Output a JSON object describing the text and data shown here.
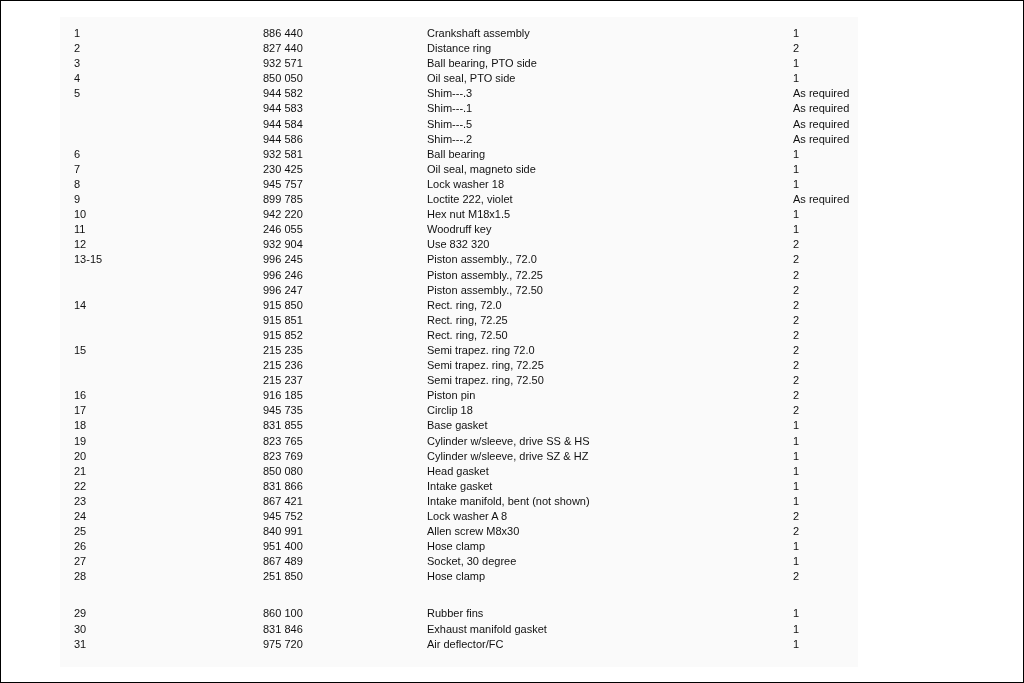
{
  "parts_list": {
    "row_groups": [
      [
        {
          "item": "1",
          "part_no": "886 440",
          "description": "Crankshaft assembly",
          "qty": "1"
        },
        {
          "item": "2",
          "part_no": "827 440",
          "description": "Distance ring",
          "qty": "2"
        },
        {
          "item": "3",
          "part_no": "932 571",
          "description": "Ball bearing, PTO side",
          "qty": "1"
        },
        {
          "item": "4",
          "part_no": "850 050",
          "description": "Oil seal, PTO side",
          "qty": "1"
        },
        {
          "item": "5",
          "part_no": "944 582",
          "description": "Shim---.3",
          "qty": "As required"
        },
        {
          "part_no": "944 583",
          "description": "Shim---.1",
          "qty": "As required"
        },
        {
          "part_no": "944 584",
          "description": "Shim---.5",
          "qty": "As required"
        },
        {
          "part_no": "944 586",
          "description": "Shim---.2",
          "qty": "As required"
        },
        {
          "item": "6",
          "part_no": "932 581",
          "description": "Ball bearing",
          "qty": "1"
        },
        {
          "item": "7",
          "part_no": "230 425",
          "description": "Oil seal, magneto side",
          "qty": "1"
        },
        {
          "item": "8",
          "part_no": "945 757",
          "description": "Lock washer 18",
          "qty": "1"
        },
        {
          "item": "9",
          "part_no": "899 785",
          "description": "Loctite 222, violet",
          "qty": "As required"
        },
        {
          "item": "10",
          "part_no": "942 220",
          "description": "Hex nut M18x1.5",
          "qty": "1"
        },
        {
          "item": "11",
          "part_no": "246 055",
          "description": "Woodruff key",
          "qty": "1"
        },
        {
          "item": "12",
          "part_no": "932 904",
          "description": "Use 832 320",
          "qty": "2"
        },
        {
          "item": "13-15",
          "part_no": "996 245",
          "description": "Piston assembly., 72.0",
          "qty": "2"
        },
        {
          "part_no": "996 246",
          "description": "Piston assembly., 72.25",
          "qty": "2"
        },
        {
          "part_no": "996 247",
          "description": "Piston assembly., 72.50",
          "qty": "2"
        },
        {
          "item": "14",
          "part_no": "915 850",
          "description": "Rect. ring, 72.0",
          "qty": "2"
        },
        {
          "part_no": "915 851",
          "description": "Rect. ring, 72.25",
          "qty": "2"
        },
        {
          "part_no": "915 852",
          "description": "Rect. ring, 72.50",
          "qty": "2"
        },
        {
          "item": "15",
          "part_no": "215 235",
          "description": "Semi trapez. ring 72.0",
          "qty": "2"
        },
        {
          "part_no": "215 236",
          "description": "Semi trapez. ring, 72.25",
          "qty": "2"
        },
        {
          "part_no": "215 237",
          "description": "Semi trapez. ring, 72.50",
          "qty": "2"
        },
        {
          "item": "16",
          "part_no": "916 185",
          "description": "Piston pin",
          "qty": "2"
        },
        {
          "item": "17",
          "part_no": "945 735",
          "description": "Circlip 18",
          "qty": "2"
        },
        {
          "item": "18",
          "part_no": "831 855",
          "description": "Base gasket",
          "qty": "1"
        },
        {
          "item": "19",
          "part_no": "823 765",
          "description": "Cylinder w/sleeve, drive SS & HS",
          "qty": "1"
        },
        {
          "item": "20",
          "part_no": "823 769",
          "description": "Cylinder w/sleeve, drive SZ & HZ",
          "qty": "1"
        },
        {
          "item": "21",
          "part_no": "850 080",
          "description": "Head gasket",
          "qty": "1"
        },
        {
          "item": "22",
          "part_no": "831 866",
          "description": "Intake gasket",
          "qty": "1"
        },
        {
          "item": "23",
          "part_no": "867 421",
          "description": "Intake manifold, bent (not shown)",
          "qty": "1"
        },
        {
          "item": "24",
          "part_no": "945 752",
          "description": "Lock washer A 8",
          "qty": "2"
        },
        {
          "item": "25",
          "part_no": "840 991",
          "description": "Allen screw M8x30",
          "qty": "2"
        },
        {
          "item": "26",
          "part_no": "951 400",
          "description": "Hose clamp",
          "qty": "1"
        },
        {
          "item": "27",
          "part_no": "867 489",
          "description": "Socket, 30 degree",
          "qty": "1"
        },
        {
          "item": "28",
          "part_no": "251 850",
          "description": "Hose clamp",
          "qty": "2"
        }
      ],
      [
        {
          "item": "29",
          "part_no": "860 100",
          "description": "Rubber fins",
          "qty": "1"
        },
        {
          "item": "30",
          "part_no": "831 846",
          "description": "Exhaust manifold gasket",
          "qty": "1"
        },
        {
          "item": "31",
          "part_no": "975 720",
          "description": "Air deflector/FC",
          "qty": "1"
        }
      ]
    ]
  }
}
